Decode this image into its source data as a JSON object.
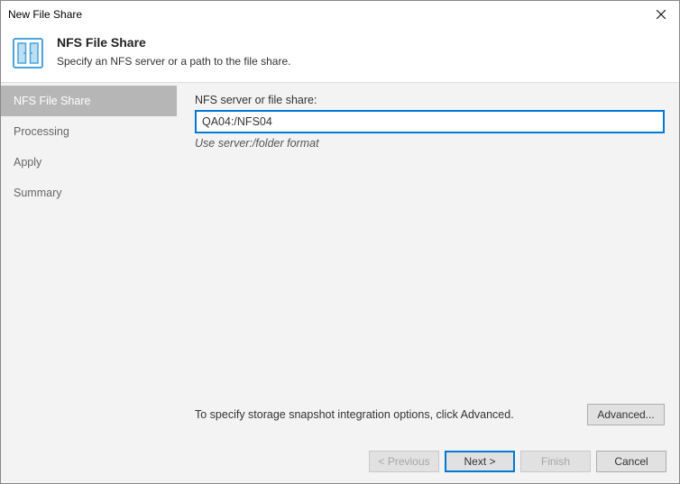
{
  "window": {
    "title": "New File Share"
  },
  "header": {
    "title": "NFS File Share",
    "subtitle": "Specify an NFS server or a path to the file share."
  },
  "sidebar": {
    "items": [
      {
        "label": "NFS File Share",
        "active": true
      },
      {
        "label": "Processing",
        "active": false
      },
      {
        "label": "Apply",
        "active": false
      },
      {
        "label": "Summary",
        "active": false
      }
    ]
  },
  "main": {
    "field_label": "NFS server or file share:",
    "field_value": "QA04:/NFS04",
    "field_hint": "Use server:/folder format",
    "bottom_text": "To specify storage snapshot integration options, click Advanced.",
    "advanced_label": "Advanced..."
  },
  "footer": {
    "previous": "< Previous",
    "next": "Next >",
    "finish": "Finish",
    "cancel": "Cancel"
  }
}
